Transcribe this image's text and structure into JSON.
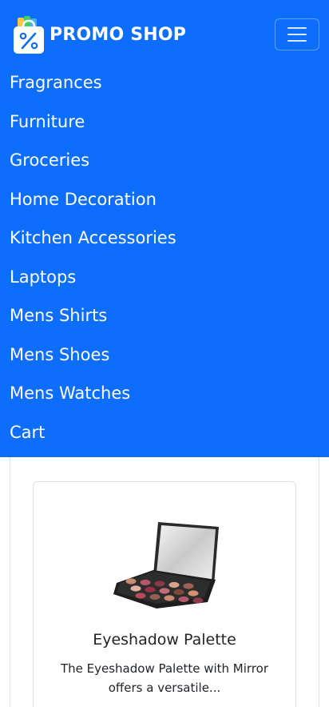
{
  "brand": {
    "name": "PROMO SHOP",
    "logo_icon": "shopping-bag-percent-icon"
  },
  "navbar": {
    "background_color": "#0d6efd",
    "toggler_icon": "hamburger-menu-icon",
    "items": [
      {
        "label": "Fragrances"
      },
      {
        "label": "Furniture"
      },
      {
        "label": "Groceries"
      },
      {
        "label": "Home Decoration"
      },
      {
        "label": "Kitchen Accessories"
      },
      {
        "label": "Laptops"
      },
      {
        "label": "Mens Shirts"
      },
      {
        "label": "Mens Shoes"
      },
      {
        "label": "Mens Watches"
      },
      {
        "label": "Cart"
      }
    ]
  },
  "product": {
    "image_icon": "eyeshadow-palette-image",
    "title": "Eyeshadow Palette",
    "description": "The Eyeshadow Palette with Mirror offers a versatile..."
  }
}
